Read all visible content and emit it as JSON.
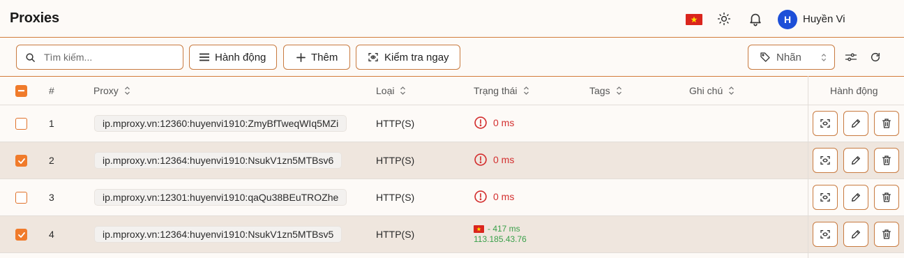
{
  "header": {
    "title": "Proxies",
    "user": {
      "initial": "H",
      "name": "Huyền Vi"
    },
    "icons": [
      "vietnam-flag-icon",
      "sun-icon",
      "bell-icon"
    ]
  },
  "toolbar": {
    "search_placeholder": "Tìm kiếm...",
    "actions_label": "Hành động",
    "add_label": "Thêm",
    "check_now_label": "Kiểm tra ngay",
    "tag_filter_label": "Nhãn"
  },
  "table": {
    "columns": {
      "index": "#",
      "proxy": "Proxy",
      "type": "Loại",
      "status": "Trạng thái",
      "tags": "Tags",
      "note": "Ghi chú",
      "actions": "Hành động"
    },
    "rows": [
      {
        "index": "1",
        "selected": false,
        "proxy": "ip.mproxy.vn:12360:huyenvi1910:ZmyBfTweqWIq5MZi",
        "type": "HTTP(S)",
        "status": "0 ms",
        "ok": false
      },
      {
        "index": "2",
        "selected": true,
        "proxy": "ip.mproxy.vn:12364:huyenvi1910:NsukV1zn5MTBsv6",
        "type": "HTTP(S)",
        "status": "0 ms",
        "ok": false
      },
      {
        "index": "3",
        "selected": false,
        "proxy": "ip.mproxy.vn:12301:huyenvi1910:qaQu38BEuTROZhe",
        "type": "HTTP(S)",
        "status": "0 ms",
        "ok": false
      },
      {
        "index": "4",
        "selected": true,
        "proxy": "ip.mproxy.vn:12364:huyenvi1910:NsukV1zn5MTBsv5",
        "type": "HTTP(S)",
        "status": "- 417 ms",
        "ip": "113.185.43.76",
        "ok": true
      }
    ]
  },
  "colors": {
    "accent": "#f07b2b",
    "border": "#c87a3f",
    "error": "#d32f2f",
    "success": "#3aa04a",
    "selected_row": "#efe6de",
    "avatar": "#1d4fd8"
  }
}
